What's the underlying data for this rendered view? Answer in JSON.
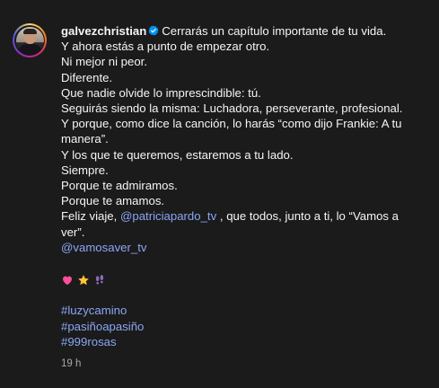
{
  "post": {
    "username": "galvezchristian",
    "lines": [
      "Cerrarás un capítulo importante de tu vida.",
      "Y ahora estás a punto de empezar otro.",
      "Ni mejor ni peor.",
      "Diferente.",
      "Que nadie olvide lo imprescindible: tú.",
      "Seguirás siendo la misma: Luchadora, perseverante, profesional.",
      "Y porque, como dice la canción, lo harás “como dijo Frankie: A tu",
      "manera”.",
      "Y los que te queremos, estaremos a tu lado.",
      "Siempre.",
      "Porque te admiramos.",
      "Porque te amamos."
    ],
    "farewell_prefix": "Feliz viaje, ",
    "farewell_mention": "@patriciapardo_tv",
    "farewell_suffix": " , que todos, junto a ti, lo “Vamos a",
    "farewell_end": "ver”.",
    "mention2": "@vamosaver_tv",
    "emojis": [
      "heart-emoji",
      "star-emoji",
      "footprints-emoji"
    ],
    "hashtags": [
      "#luzycamino",
      "#pasiñoapasiño",
      "#999rosas"
    ],
    "timestamp": "19 h"
  },
  "colors": {
    "background": "#1b1b1b",
    "text": "#f5f5f5",
    "link": "#8aa7f5",
    "muted": "#a8a8a8",
    "verified": "#0095f6"
  }
}
